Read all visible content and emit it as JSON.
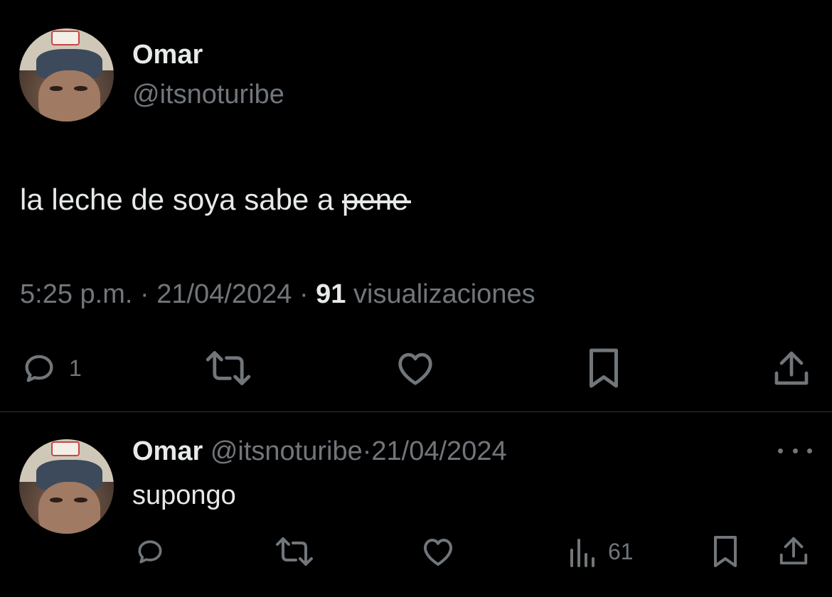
{
  "main_tweet": {
    "author": {
      "display_name": "Omar",
      "handle": "@itsnoturibe"
    },
    "text": "la leche de soya sabe a ",
    "censored_word": "pene",
    "time": "5:25 p.m.",
    "date": "21/04/2024",
    "separator": " · ",
    "views_count": "91",
    "views_label": " visualizaciones",
    "actions": {
      "reply_count": "1"
    }
  },
  "reply": {
    "author": {
      "display_name": "Omar",
      "handle": "@itsnoturibe"
    },
    "separator": "·",
    "date": "21/04/2024",
    "text": "supongo",
    "actions": {
      "views_count": "61"
    }
  },
  "icons": {
    "reply": "reply-icon",
    "retweet": "retweet-icon",
    "like": "heart-icon",
    "bookmark": "bookmark-icon",
    "share": "share-icon",
    "analytics": "analytics-icon",
    "more": "more-icon"
  },
  "colors": {
    "background": "#000000",
    "text_primary": "#e7e9ea",
    "text_secondary": "#71767b",
    "divider": "#2f3336"
  }
}
